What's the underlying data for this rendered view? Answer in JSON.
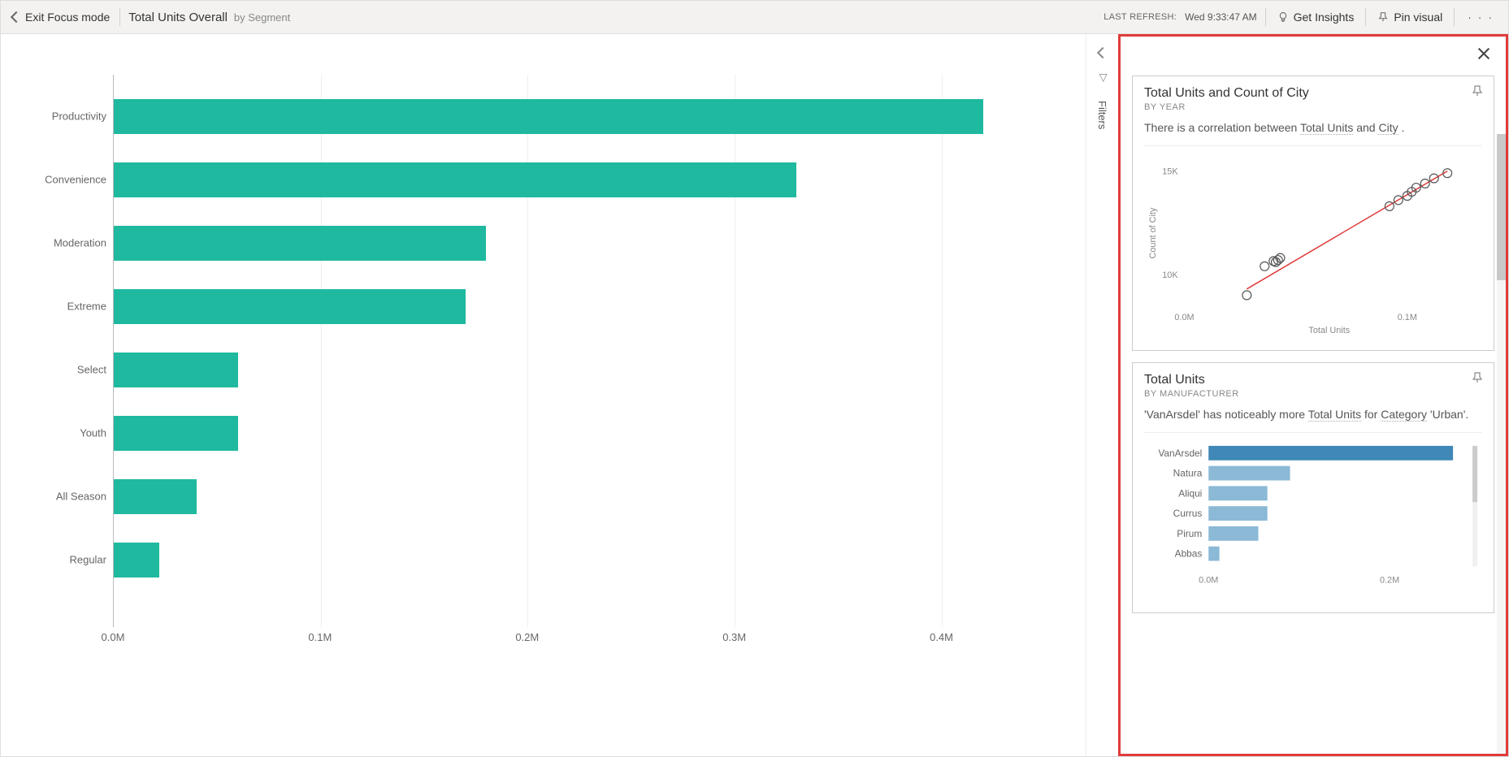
{
  "toolbar": {
    "exit_label": "Exit Focus mode",
    "title": "Total Units Overall",
    "subtitle": "by Segment",
    "refresh_label": "LAST REFRESH:",
    "refresh_time": "Wed 9:33:47 AM",
    "get_insights": "Get Insights",
    "pin_visual": "Pin visual"
  },
  "filters_label": "Filters",
  "insight1": {
    "title": "Total Units and Count of City",
    "sub": "BY YEAR",
    "desc_pre": "There is a correlation between ",
    "desc_u1": "Total Units",
    "desc_mid": " and ",
    "desc_u2": "City",
    "desc_post": " .",
    "xlabel": "Total Units",
    "ylabel": "Count of City",
    "y_ticks": [
      "10K",
      "15K"
    ],
    "x_ticks": [
      "0.0M",
      "0.1M"
    ]
  },
  "insight2": {
    "title": "Total Units",
    "sub": "BY MANUFACTURER",
    "desc_pre": "'VanArsdel' has noticeably more ",
    "desc_u1": "Total Units",
    "desc_mid": " for ",
    "desc_u2": "Category",
    "desc_post": " 'Urban'.",
    "x_ticks": [
      "0.0M",
      "0.2M"
    ]
  },
  "chart_data": [
    {
      "type": "bar",
      "orientation": "horizontal",
      "title": "Total Units Overall by Segment",
      "categories": [
        "Productivity",
        "Convenience",
        "Moderation",
        "Extreme",
        "Select",
        "Youth",
        "All Season",
        "Regular"
      ],
      "values": [
        0.42,
        0.33,
        0.18,
        0.17,
        0.06,
        0.06,
        0.04,
        0.022
      ],
      "xlabel": "",
      "ylabel": "",
      "xlim": [
        0,
        0.45
      ],
      "x_ticks": [
        0.0,
        0.1,
        0.2,
        0.3,
        0.4
      ],
      "x_tick_labels": [
        "0.0M",
        "0.1M",
        "0.2M",
        "0.3M",
        "0.4M"
      ],
      "value_unit": "M",
      "color": "#1fb99f"
    },
    {
      "type": "scatter",
      "title": "Total Units and Count of City by Year",
      "xlabel": "Total Units",
      "ylabel": "Count of City",
      "xlim": [
        0,
        0.13
      ],
      "ylim": [
        8500,
        15500
      ],
      "x_ticks": [
        0.0,
        0.1
      ],
      "x_tick_labels": [
        "0.0M",
        "0.1M"
      ],
      "y_ticks": [
        10000,
        15000
      ],
      "y_tick_labels": [
        "10K",
        "15K"
      ],
      "series": [
        {
          "name": "Years",
          "x": [
            0.028,
            0.036,
            0.04,
            0.041,
            0.042,
            0.043,
            0.092,
            0.096,
            0.1,
            0.102,
            0.104,
            0.108,
            0.112,
            0.118
          ],
          "y": [
            9000,
            10400,
            10650,
            10600,
            10700,
            10800,
            13300,
            13600,
            13800,
            14000,
            14200,
            14400,
            14650,
            14900
          ]
        }
      ],
      "trendline": {
        "x": [
          0.028,
          0.118
        ],
        "y": [
          9300,
          15000
        ],
        "color": "#e03b3b"
      }
    },
    {
      "type": "bar",
      "orientation": "horizontal",
      "title": "Total Units by Manufacturer",
      "categories": [
        "VanArsdel",
        "Natura",
        "Aliqui",
        "Currus",
        "Pirum",
        "Abbas"
      ],
      "values": [
        0.27,
        0.09,
        0.065,
        0.065,
        0.055,
        0.012
      ],
      "xlim": [
        0,
        0.28
      ],
      "x_ticks": [
        0.0,
        0.2
      ],
      "x_tick_labels": [
        "0.0M",
        "0.2M"
      ],
      "highlight_index": 0,
      "color": "#8bb9d6",
      "highlight_color": "#3f88b7"
    }
  ]
}
